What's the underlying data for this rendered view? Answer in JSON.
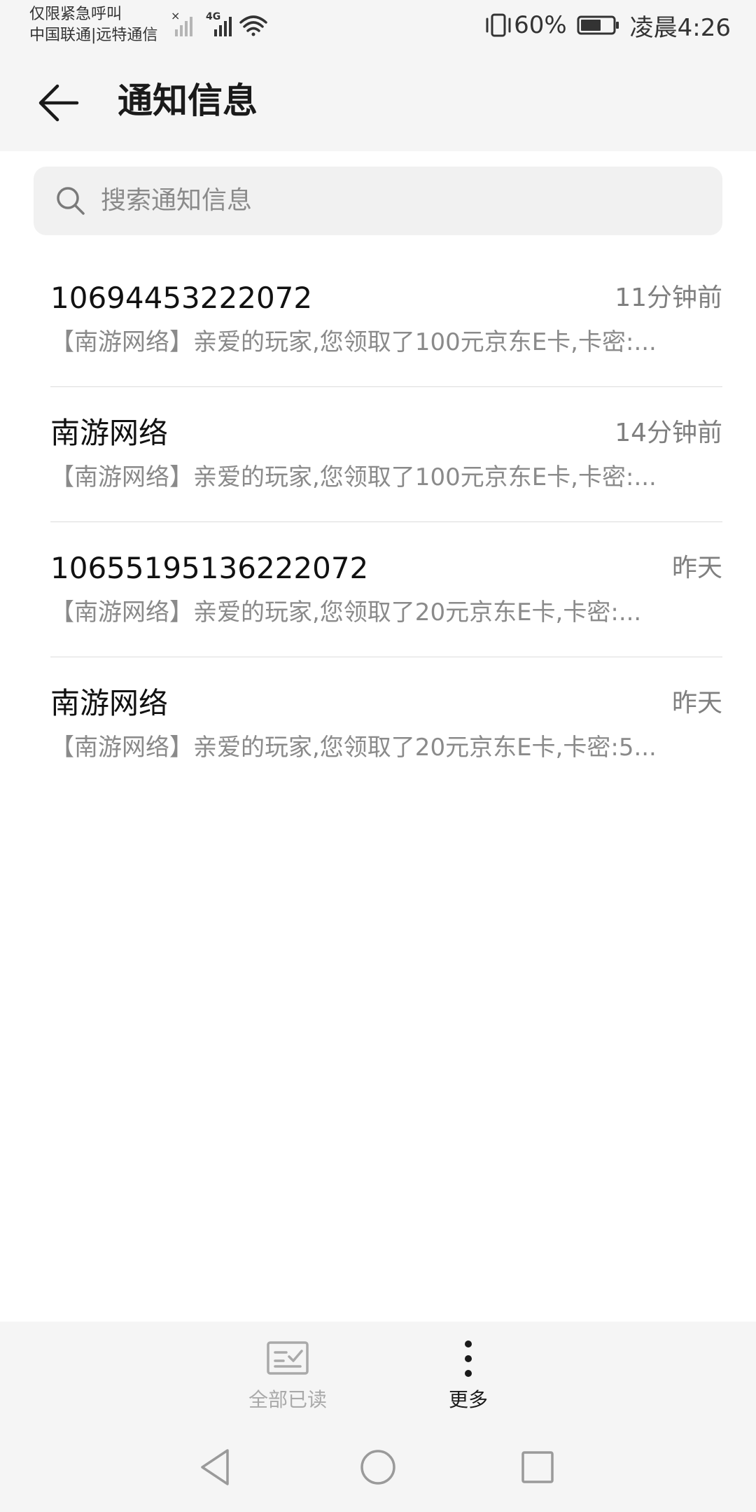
{
  "status_bar": {
    "carrier_line1": "仅限紧急呼叫",
    "carrier_line2": "中国联通|远特通信",
    "network_type": "4G",
    "battery_percent": "60%",
    "time": "凌晨4:26",
    "icons": [
      "no-signal-icon",
      "signal-icon",
      "wifi-icon",
      "vibrate-icon",
      "battery-icon"
    ]
  },
  "header": {
    "title": "通知信息",
    "back_icon": "back-arrow-icon"
  },
  "search": {
    "placeholder": "搜索通知信息",
    "icon": "search-icon"
  },
  "messages": [
    {
      "sender": "10694453222072",
      "time": "11分钟前",
      "preview": "【南游网络】亲爱的玩家,您领取了100元京东E卡,卡密:..."
    },
    {
      "sender": "南游网络",
      "time": "14分钟前",
      "preview": "【南游网络】亲爱的玩家,您领取了100元京东E卡,卡密:..."
    },
    {
      "sender": "10655195136222072",
      "time": "昨天",
      "preview": "【南游网络】亲爱的玩家,您领取了20元京东E卡,卡密:..."
    },
    {
      "sender": "南游网络",
      "time": "昨天",
      "preview": "【南游网络】亲爱的玩家,您领取了20元京东E卡,卡密:5..."
    }
  ],
  "toolbar": {
    "mark_all_read_label": "全部已读",
    "more_label": "更多"
  },
  "colors": {
    "bar_background": "#f5f5f5",
    "search_background": "#f1f1f1",
    "primary_text": "#1a1a1a",
    "secondary_text": "#8a8a8a",
    "disabled_text": "#a9a9a9",
    "divider": "#dcdcdc"
  }
}
